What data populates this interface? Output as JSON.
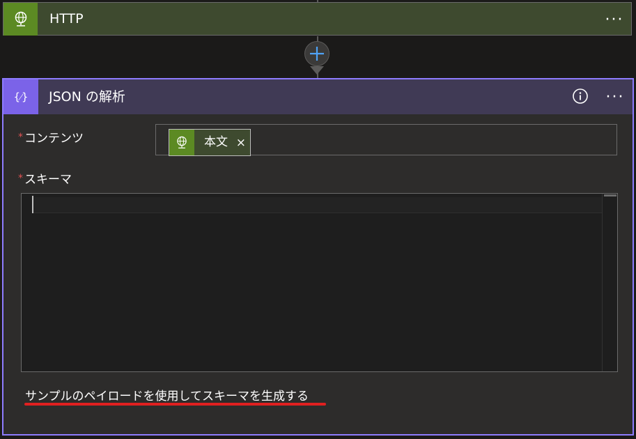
{
  "http_step": {
    "title": "HTTP",
    "icon": "globe-icon",
    "more_label": "···"
  },
  "connector": {
    "add_icon": "plus-icon"
  },
  "json_step": {
    "title": "JSON の解析",
    "icon": "braces-icon",
    "icon_text": "{⁄}",
    "info_icon": "info-icon",
    "more_label": "···",
    "content_field": {
      "label": "コンテンツ",
      "required_mark": "*",
      "token": {
        "label": "本文",
        "icon": "globe-icon",
        "remove_label": "×"
      }
    },
    "schema_field": {
      "label": "スキーマ",
      "required_mark": "*",
      "value": ""
    },
    "generate_link": "サンプルのペイロードを使用してスキーマを生成する"
  },
  "colors": {
    "http_accent": "#5c8a23",
    "json_accent": "#7b63e8",
    "card_border": "#8e7cff",
    "annotation_underline": "#e02020"
  }
}
